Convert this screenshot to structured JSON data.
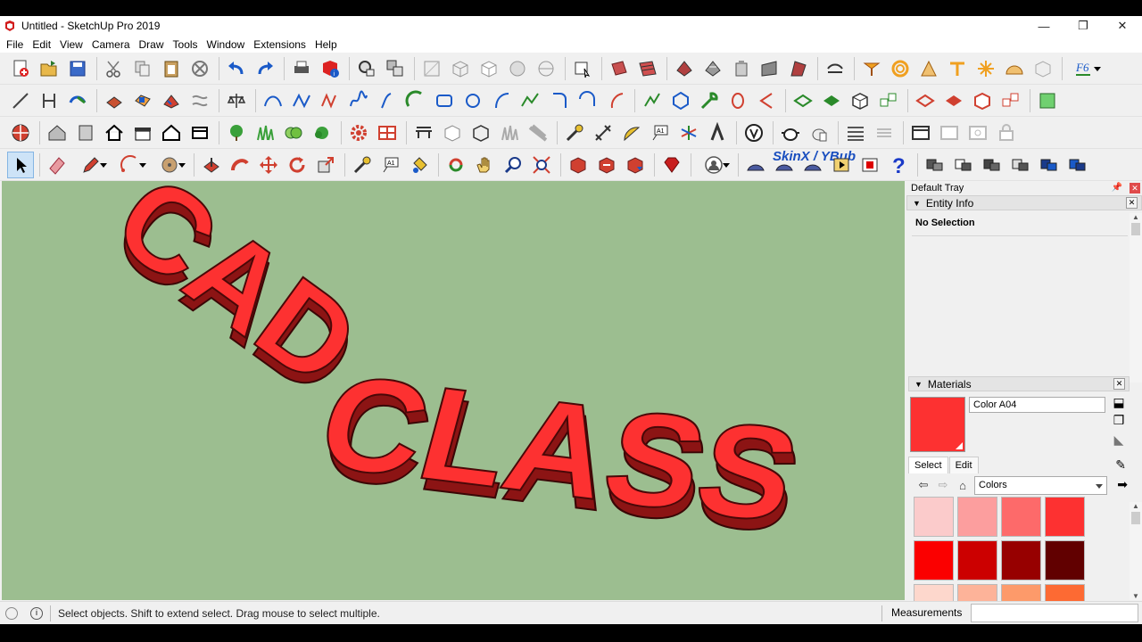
{
  "window": {
    "title": "Untitled - SketchUp Pro 2019",
    "minimize": "—",
    "restore": "❐",
    "close": "✕"
  },
  "menu": [
    "File",
    "Edit",
    "View",
    "Camera",
    "Draw",
    "Tools",
    "Window",
    "Extensions",
    "Help"
  ],
  "toolbar": {
    "skinx_label": "SkinX / YBub"
  },
  "viewport": {
    "model_text": "CAD CLASS",
    "background": "#9cbe90",
    "text_color": "#fd3131"
  },
  "tray": {
    "title": "Default Tray",
    "entity_info": {
      "header": "Entity Info",
      "status": "No Selection"
    },
    "materials": {
      "header": "Materials",
      "current_name": "Color A04",
      "current_color": "#fd3131",
      "tabs": [
        "Select",
        "Edit"
      ],
      "library": "Colors",
      "swatches": [
        "#fbcbcb",
        "#fc9e9e",
        "#fd6a6a",
        "#fd3131",
        "#fb0000",
        "#cc0000",
        "#970000",
        "#610000",
        "#fdd7cc",
        "#fdb399",
        "#fd9a6a",
        "#fd6a33"
      ]
    }
  },
  "statusbar": {
    "hint": "Select objects. Shift to extend select. Drag mouse to select multiple.",
    "measurements_label": "Measurements"
  }
}
